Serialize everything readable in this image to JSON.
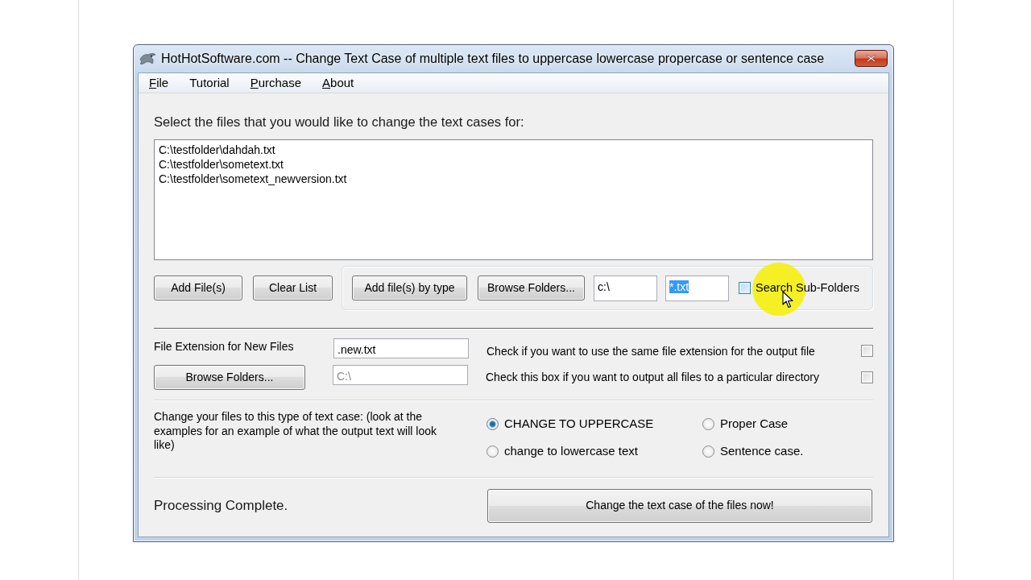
{
  "window": {
    "title": "HotHotSoftware.com -- Change Text Case of multiple text files to uppercase lowercase propercase or sentence case"
  },
  "menu": [
    {
      "label": "File",
      "mnemonic_underlined": true
    },
    {
      "label": "Tutorial",
      "mnemonic_underlined": false
    },
    {
      "label": "Purchase",
      "mnemonic_underlined": true
    },
    {
      "label": "About",
      "mnemonic_underlined": true
    }
  ],
  "file_list": {
    "label": "Select the files that you would like to change the text cases for:",
    "items": [
      "C:\\testfolder\\dahdah.txt",
      "C:\\testfolder\\sometext.txt",
      "C:\\testfolder\\sometext_newversion.txt"
    ]
  },
  "list_buttons": [
    "Add File(s)",
    "Clear List"
  ],
  "by_type": {
    "buttons": [
      "Add file(s) by type",
      "Browse Folders..."
    ],
    "folder_field": {
      "value": "c:\\"
    },
    "type_field": {
      "value": "*.txt",
      "text_selected": true
    },
    "subfolders": {
      "label": "Search Sub-Folders",
      "checked": false,
      "hovered": true
    }
  },
  "output": {
    "extension_label": "File Extension for New Files",
    "extension_field": {
      "value": ".new.txt"
    },
    "browse_button": "Browse Folders...",
    "directory_field": {
      "value": "C:\\",
      "disabled": true
    },
    "options": [
      {
        "label": "Check if you want to use the same file extension for the output file",
        "checked": false
      },
      {
        "label": "Check this box if you want to output all files to a particular directory",
        "checked": false
      }
    ]
  },
  "text_case": {
    "description": "Change your files to this type of text case: (look at the examples for an example of what the output text will look like)",
    "options": [
      {
        "label": "CHANGE TO UPPERCASE",
        "selected": true
      },
      {
        "label": "Proper Case",
        "selected": false
      },
      {
        "label": "change to lowercase text",
        "selected": false
      },
      {
        "label": "Sentence case.",
        "selected": false
      }
    ]
  },
  "status": "Processing Complete.",
  "run_button": "Change the text case of the files now!"
}
